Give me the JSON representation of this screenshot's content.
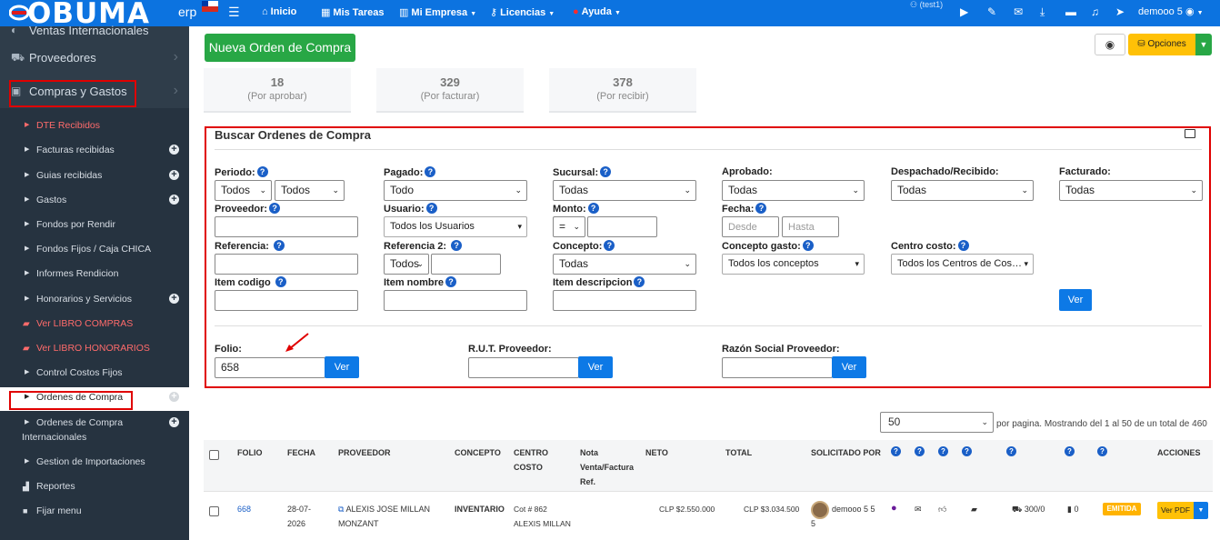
{
  "topbar": {
    "logo": "OBUMA",
    "logo_suffix": "erp",
    "nav": [
      "Inicio",
      "Mis Tareas",
      "Mi Empresa",
      "Licencias",
      "Ayuda"
    ],
    "company": "(test1)",
    "user": "demooo 5"
  },
  "sidebar": {
    "main": [
      "Ventas Internacionales",
      "Proveedores",
      "Compras y Gastos"
    ],
    "items": [
      {
        "label": "DTE Recibidos",
        "red": true
      },
      {
        "label": "Facturas recibidas",
        "plus": true
      },
      {
        "label": "Guias recibidas",
        "plus": true
      },
      {
        "label": "Gastos",
        "plus": true
      },
      {
        "label": "Fondos por Rendir"
      },
      {
        "label": "Fondos Fijos / Caja CHICA"
      },
      {
        "label": "Informes Rendicion"
      },
      {
        "label": "Honorarios y Servicios",
        "plus": true
      },
      {
        "label": "Ver LIBRO COMPRAS",
        "red": true
      },
      {
        "label": "Ver LIBRO HONORARIOS",
        "red": true
      },
      {
        "label": "Control Costos Fijos"
      },
      {
        "label": "Ordenes de Compra",
        "active": true
      },
      {
        "label": "Ordenes de Compra",
        "label2": "Internacionales",
        "plus": true
      },
      {
        "label": "Gestion de Importaciones"
      },
      {
        "label": "Reportes"
      },
      {
        "label": "Fijar menu"
      }
    ]
  },
  "header": {
    "new_button": "Nueva Orden de Compra",
    "options": "Opciones"
  },
  "stats": [
    {
      "num": "18",
      "label": "(Por aprobar)"
    },
    {
      "num": "329",
      "label": "(Por facturar)"
    },
    {
      "num": "378",
      "label": "(Por recibir)"
    }
  ],
  "search": {
    "title": "Buscar Ordenes de Compra",
    "periodo": "Periodo:",
    "periodo_v1": "Todos",
    "periodo_v2": "Todos",
    "pagado": "Pagado:",
    "pagado_v": "Todo",
    "sucursal": "Sucursal:",
    "sucursal_v": "Todas",
    "aprobado": "Aprobado:",
    "aprobado_v": "Todas",
    "despachado": "Despachado/Recibido:",
    "despachado_v": "Todas",
    "facturado": "Facturado:",
    "facturado_v": "Todas",
    "proveedor": "Proveedor:",
    "usuario": "Usuario:",
    "usuario_v": "Todos los Usuarios",
    "monto": "Monto:",
    "monto_op": "=",
    "fecha": "Fecha:",
    "fecha_desde": "Desde",
    "fecha_hasta": "Hasta",
    "referencia": "Referencia:",
    "referencia2": "Referencia 2:",
    "referencia2_v": "Todos",
    "concepto": "Concepto:",
    "concepto_v": "Todas",
    "concepto_gasto": "Concepto gasto:",
    "concepto_gasto_v": "Todos los conceptos",
    "centro_costo": "Centro costo:",
    "centro_costo_v": "Todos los Centros de Cos…",
    "item_codigo": "Item codigo",
    "item_nombre": "Item nombre",
    "item_descripcion": "Item descripcion",
    "ver": "Ver",
    "folio": "Folio:",
    "folio_v": "658",
    "rut": "R.U.T. Proveedor:",
    "razon": "Razón Social Proveedor:"
  },
  "table": {
    "per_page": "50",
    "per_page_text": "por pagina. Mostrando del 1 al 50 de un total de 460",
    "headers": {
      "folio": "FOLIO",
      "fecha": "FECHA",
      "proveedor": "PROVEEDOR",
      "concepto": "CONCEPTO",
      "centro": "CENTRO",
      "costo": "COSTO",
      "nota1": "Nota",
      "nota2": "Venta/Factura",
      "nota3": "Ref.",
      "neto": "NETO",
      "total": "TOTAL",
      "solicitado": "SOLICITADO POR",
      "acciones": "ACCIONES"
    },
    "row": {
      "folio": "668",
      "fecha1": "28-07-",
      "fecha2": "2026",
      "prov1": "ALEXIS JOSE MILLAN",
      "prov2": "MONZANT",
      "concepto": "INVENTARIO",
      "cc1": "Cot # 862",
      "cc2": "ALEXIS MILLAN",
      "neto": "CLP $2.550.000",
      "total": "CLP $3.034.500",
      "sol1": "demooo 5 5",
      "sol2": "5",
      "cart": "300/0",
      "doc": "0",
      "estado": "EMITIDA",
      "ver_pdf": "Ver PDF"
    }
  }
}
